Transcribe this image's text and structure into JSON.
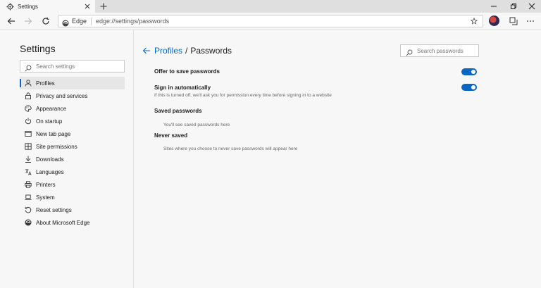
{
  "tab": {
    "title": "Settings"
  },
  "address_bar": {
    "site_label": "Edge",
    "url": "edge://settings/passwords"
  },
  "sidebar": {
    "title": "Settings",
    "search_placeholder": "Search settings",
    "items": [
      {
        "label": "Profiles",
        "icon": "person-icon",
        "active": true
      },
      {
        "label": "Privacy and services",
        "icon": "lock-icon"
      },
      {
        "label": "Appearance",
        "icon": "palette-icon"
      },
      {
        "label": "On startup",
        "icon": "power-icon"
      },
      {
        "label": "New tab page",
        "icon": "new-tab-icon"
      },
      {
        "label": "Site permissions",
        "icon": "site-permissions-icon"
      },
      {
        "label": "Downloads",
        "icon": "download-icon"
      },
      {
        "label": "Languages",
        "icon": "languages-icon"
      },
      {
        "label": "Printers",
        "icon": "printer-icon"
      },
      {
        "label": "System",
        "icon": "laptop-icon"
      },
      {
        "label": "Reset settings",
        "icon": "reset-icon"
      },
      {
        "label": "About Microsoft Edge",
        "icon": "edge-logo-icon"
      }
    ]
  },
  "main": {
    "breadcrumb_parent": "Profiles",
    "breadcrumb_separator": "/",
    "breadcrumb_current": "Passwords",
    "search_placeholder": "Search passwords",
    "offer_to_save_label": "Offer to save passwords",
    "offer_to_save_on": true,
    "sign_in_auto_label": "Sign in automatically",
    "sign_in_auto_on": true,
    "sign_in_auto_desc": "If this is turned off, we'll ask you for permission every time before signing in to a website",
    "saved_passwords_title": "Saved passwords",
    "saved_passwords_empty": "You'll see saved passwords here",
    "never_saved_title": "Never saved",
    "never_saved_empty": "Sites where you choose to never save passwords will appear here"
  },
  "colors": {
    "accent": "#0a66c2",
    "background": "#f7f7f7"
  }
}
